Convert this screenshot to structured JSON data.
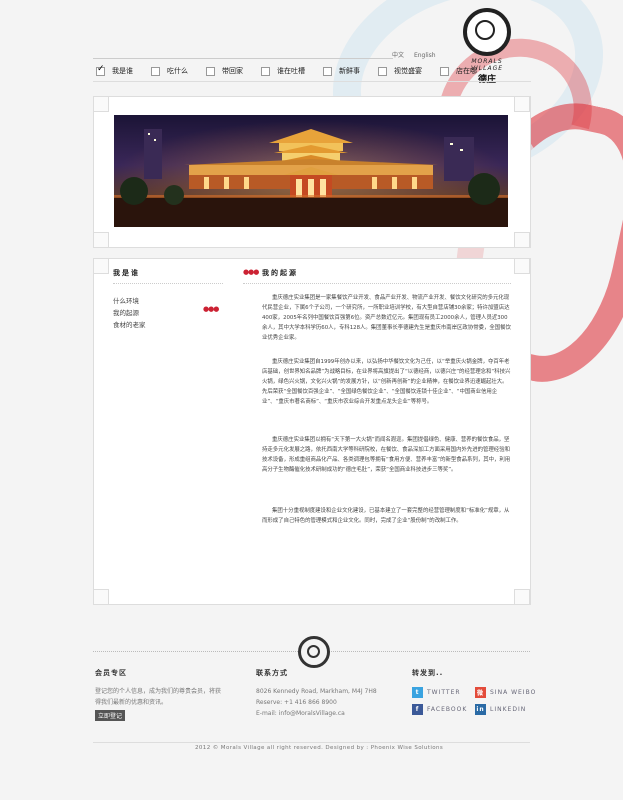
{
  "brand": {
    "logo_text": "MORALS VILLAGE",
    "logo_signature": "德庄"
  },
  "header": {
    "lang_cn": "中文",
    "lang_en": "English"
  },
  "nav": {
    "items": [
      {
        "label": "我是谁",
        "checked": true
      },
      {
        "label": "吃什么",
        "checked": false
      },
      {
        "label": "带回家",
        "checked": false
      },
      {
        "label": "谁在吐槽",
        "checked": false
      },
      {
        "label": "新鲜事",
        "checked": false
      },
      {
        "label": "视觉盛宴",
        "checked": false
      },
      {
        "label": "店在哪",
        "checked": false
      }
    ]
  },
  "sidebar": {
    "title": "我是谁",
    "items": [
      "什么环境",
      "我的起源",
      "食材的老家"
    ]
  },
  "main": {
    "title": "我的起源",
    "paragraphs": [
      "重庆德庄实业集团是一家集餐饮产业开发、食品产业开发、物流产业开发、餐饮文化研究的多元化现代民营企业，下属6个子公司，一个研究所，一所职业培训学校，有大型自营店铺30余家；特许加盟店达400家，2005年名列中国餐饮百强第6位。资产总数近亿元。集团现有员工2000余人，管理人员近300余人，其中大学本科学历60人，专科128人。集团董事长李德建先生是重庆市南岸区政协常委，全国餐饮业优秀企业家。",
      "重庆德庄实业集团自1999年创办以来，以弘扬中华餐饮文化为己任，以“举重庆火锅金牌，夺百年老店基础，创世界知名品牌”为战略目标，在业界将高旗提出了“以德经商，以德兴庄”的经营理念和“科技兴火锅，绿色兴火锅，文化兴火锅”的发展方针，以“创新再创新”的企业精神，在餐饮业界迅速崛起壮大。先后荣获“全国餐饮百强企业”、“全国绿色餐饮企业”、“全国餐饮连锁十佳企业”、“中国商业信用企业”、“重庆市著名商标”、“重庆市农业综合开发重点龙头企业”等称号。",
      "重庆德庄实业集团以拥有“天下第一大火锅”而闻名遐迩。集团提倡绿色、健康、营养的餐饮食品，坚持走多元化发展之路，依托西南大学等科研院校，在餐饮、食品深加工方面采用国内外先进的管理经验和技术设备，形成重组商品化产品、各类调理包等拥有“食用方便、营养丰富”的新型食品系列，其中，利用高分子生物酶催化技术研制成功的“德庄毛肚”，荣获“全国商业科技进步三等奖”。",
      "集团十分重视制度建设和企业文化建设，已基本建立了一套完整的经营管理制度和“标准化”规章，从而形成了自己特色的管理模式和企业文化。同时，完成了企业“股份制”的改制工作。"
    ]
  },
  "footer": {
    "member": {
      "heading": "会员专区",
      "text_1": "登记您的个人信息，成为我们的尊贵会员，将获",
      "text_2": "得我们最新的优惠和资讯。",
      "button": "立即登记"
    },
    "contact": {
      "heading": "联系方式",
      "address": "8026 Kennedy Road, Markham, M4J 7H8",
      "phone": "Reserve: +1 416 866 8900",
      "email": "E-mail: info@MoralsVillage.ca"
    },
    "share": {
      "heading": "转发到..",
      "items": [
        {
          "label": "TWITTER",
          "icon": "twitter-icon",
          "color": "#3aa3e0",
          "glyph": "t"
        },
        {
          "label": "SINA WEIBO",
          "icon": "weibo-icon",
          "color": "#e34b3a",
          "glyph": "微"
        },
        {
          "label": "FACEBOOK",
          "icon": "facebook-icon",
          "color": "#3b5998",
          "glyph": "f"
        },
        {
          "label": "LINKEDIN",
          "icon": "linkedin-icon",
          "color": "#2a6aa5",
          "glyph": "in"
        }
      ]
    },
    "copyright": "2012 © Morals Village all right reserved.  Designed by : Phoenix Wise Solutions"
  }
}
